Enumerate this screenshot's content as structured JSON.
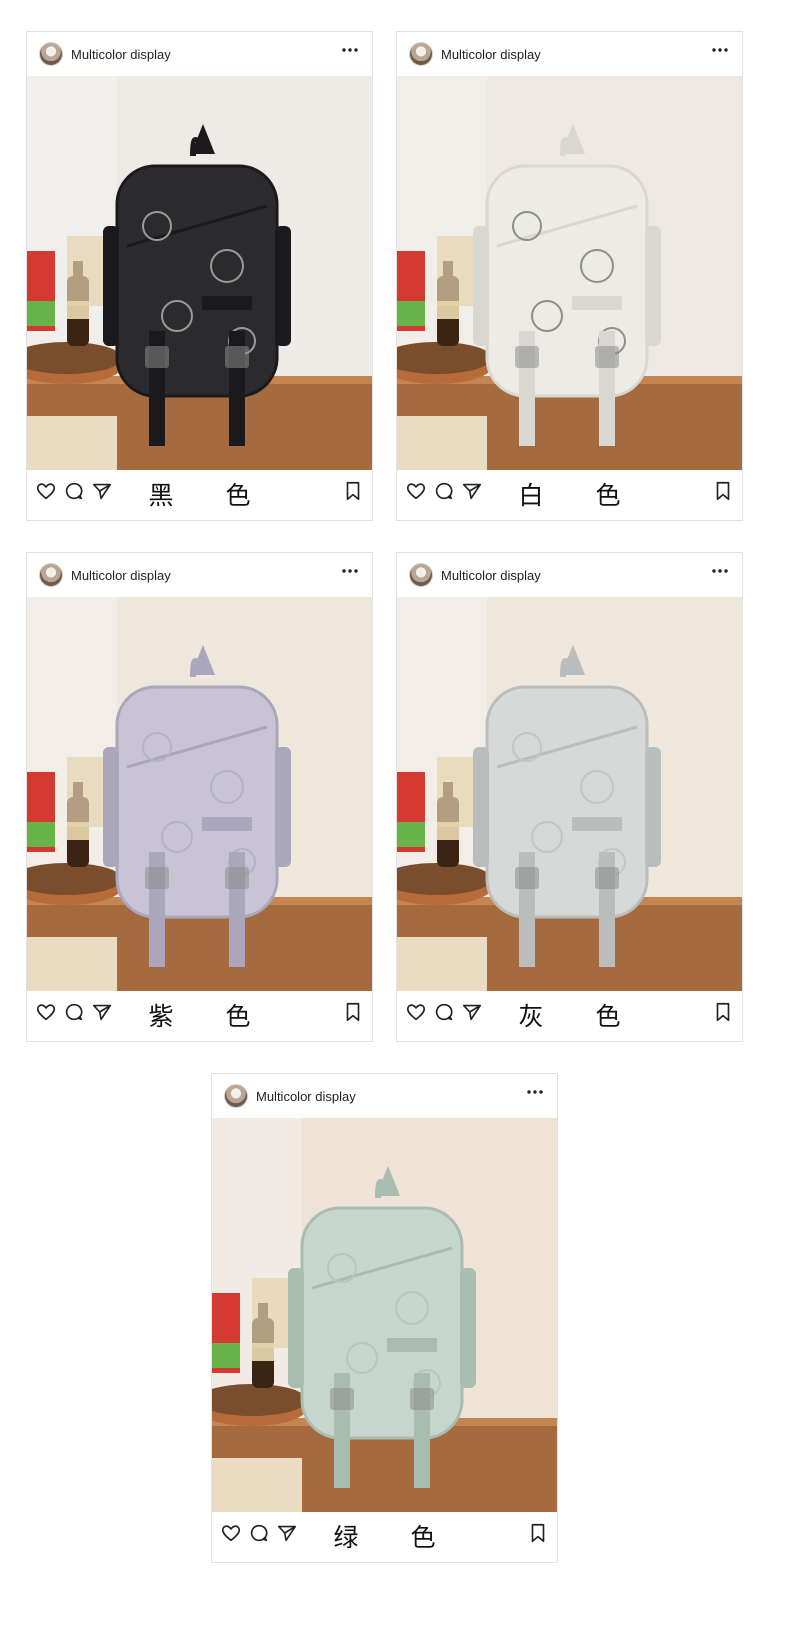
{
  "cards": [
    {
      "username": "Multicolor display",
      "color_label": "黑 色",
      "bag_color": "#2b2b2d",
      "bag_shade": "#1a1a1c",
      "pattern_color": "#9a9a9a",
      "wall_color": "#eeeae6"
    },
    {
      "username": "Multicolor display",
      "color_label": "白 色",
      "bag_color": "#ecebe6",
      "bag_shade": "#d8d7d0",
      "pattern_color": "#8f8f8a",
      "wall_color": "#ede8e2"
    },
    {
      "username": "Multicolor display",
      "color_label": "紫 色",
      "bag_color": "#c8c4d6",
      "bag_shade": "#aaa6bb",
      "pattern_color": "#b6b2c6",
      "wall_color": "#efe6dc"
    },
    {
      "username": "Multicolor display",
      "color_label": "灰 色",
      "bag_color": "#d6d9d8",
      "bag_shade": "#b9bdbb",
      "pattern_color": "#c2c6c4",
      "wall_color": "#efe6dc"
    },
    {
      "username": "Multicolor display",
      "color_label": "绿 色",
      "bag_color": "#c7d6cd",
      "bag_shade": "#a9bcb0",
      "pattern_color": "#b5c6bc",
      "wall_color": "#efe2d6"
    }
  ],
  "icons": [
    "more-icon",
    "heart-icon",
    "comment-icon",
    "share-icon",
    "bookmark-icon"
  ]
}
